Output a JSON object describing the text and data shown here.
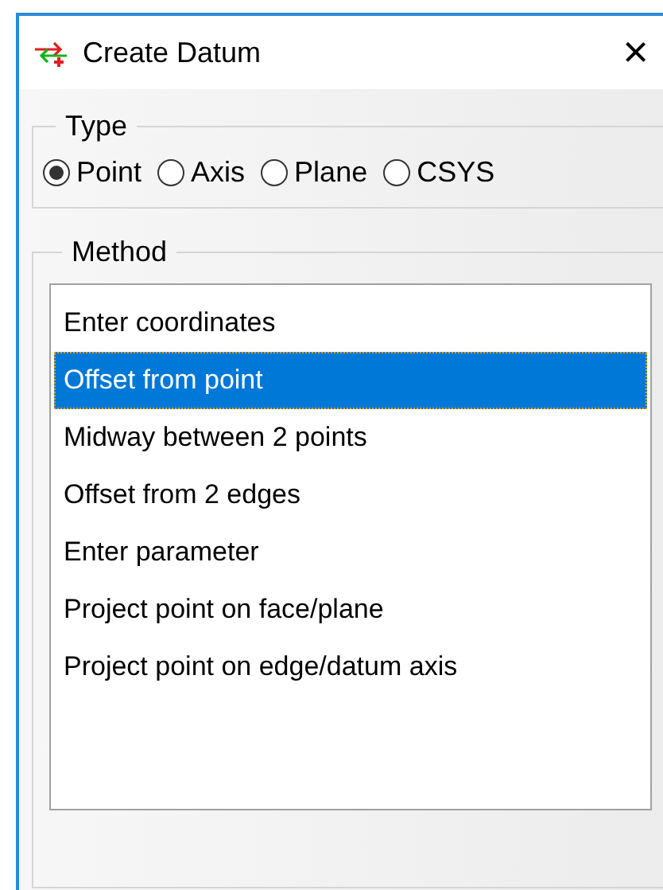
{
  "window": {
    "title": "Create Datum",
    "close": "×"
  },
  "type_group": {
    "label": "Type",
    "options": [
      {
        "label": "Point",
        "selected": true
      },
      {
        "label": "Axis",
        "selected": false
      },
      {
        "label": "Plane",
        "selected": false
      },
      {
        "label": "CSYS",
        "selected": false
      }
    ]
  },
  "method_group": {
    "label": "Method",
    "items": [
      {
        "label": "Enter coordinates",
        "selected": false
      },
      {
        "label": "Offset from point",
        "selected": true
      },
      {
        "label": "Midway between 2 points",
        "selected": false
      },
      {
        "label": "Offset from 2 edges",
        "selected": false
      },
      {
        "label": "Enter parameter",
        "selected": false
      },
      {
        "label": "Project point on face/plane",
        "selected": false
      },
      {
        "label": "Project point on edge/datum axis",
        "selected": false
      }
    ]
  }
}
